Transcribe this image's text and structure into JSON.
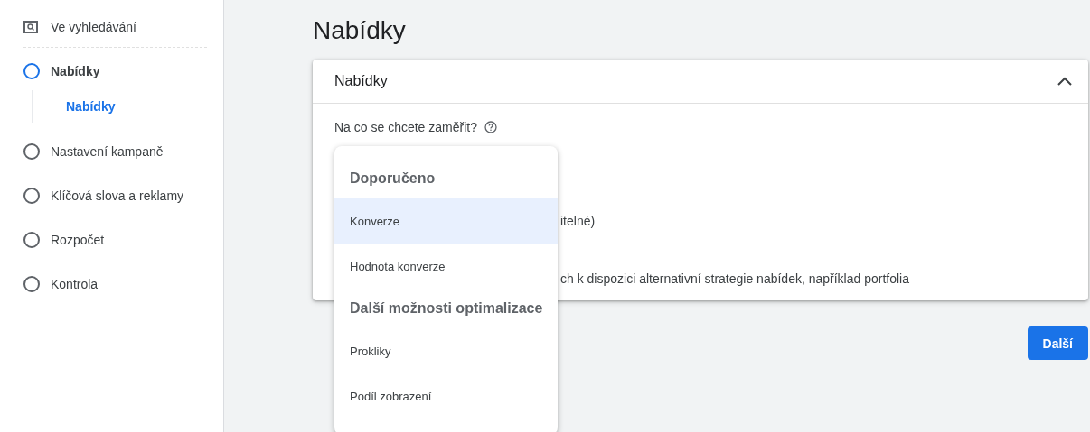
{
  "sidebar": {
    "search_item": {
      "label": "Ve vyhledávání"
    },
    "steps": [
      {
        "label": "Nabídky",
        "selected": true,
        "children": [
          {
            "label": "Nabídky",
            "selected": true
          }
        ]
      },
      {
        "label": "Nastavení kampaně",
        "selected": false
      },
      {
        "label": "Klíčová slova a reklamy",
        "selected": false
      },
      {
        "label": "Rozpočet",
        "selected": false
      },
      {
        "label": "Kontrola",
        "selected": false
      }
    ]
  },
  "page_title": "Nabídky",
  "card": {
    "title": "Nabídky",
    "expanded": true,
    "question": "Na co se chcete zaměřit?",
    "partial_lines": [
      "itelné)",
      "ch k dispozici alternativní strategie nabídek, například portfolia"
    ]
  },
  "dropdown": [
    {
      "kind": "header",
      "label": "Doporučeno"
    },
    {
      "kind": "option",
      "label": "Konverze",
      "selected": true
    },
    {
      "kind": "option",
      "label": "Hodnota konverze",
      "selected": false
    },
    {
      "kind": "header",
      "label": "Další možnosti optimalizace"
    },
    {
      "kind": "option",
      "label": "Prokliky",
      "selected": false
    },
    {
      "kind": "option",
      "label": "Podíl zobrazení",
      "selected": false
    }
  ],
  "next_button": "Další"
}
